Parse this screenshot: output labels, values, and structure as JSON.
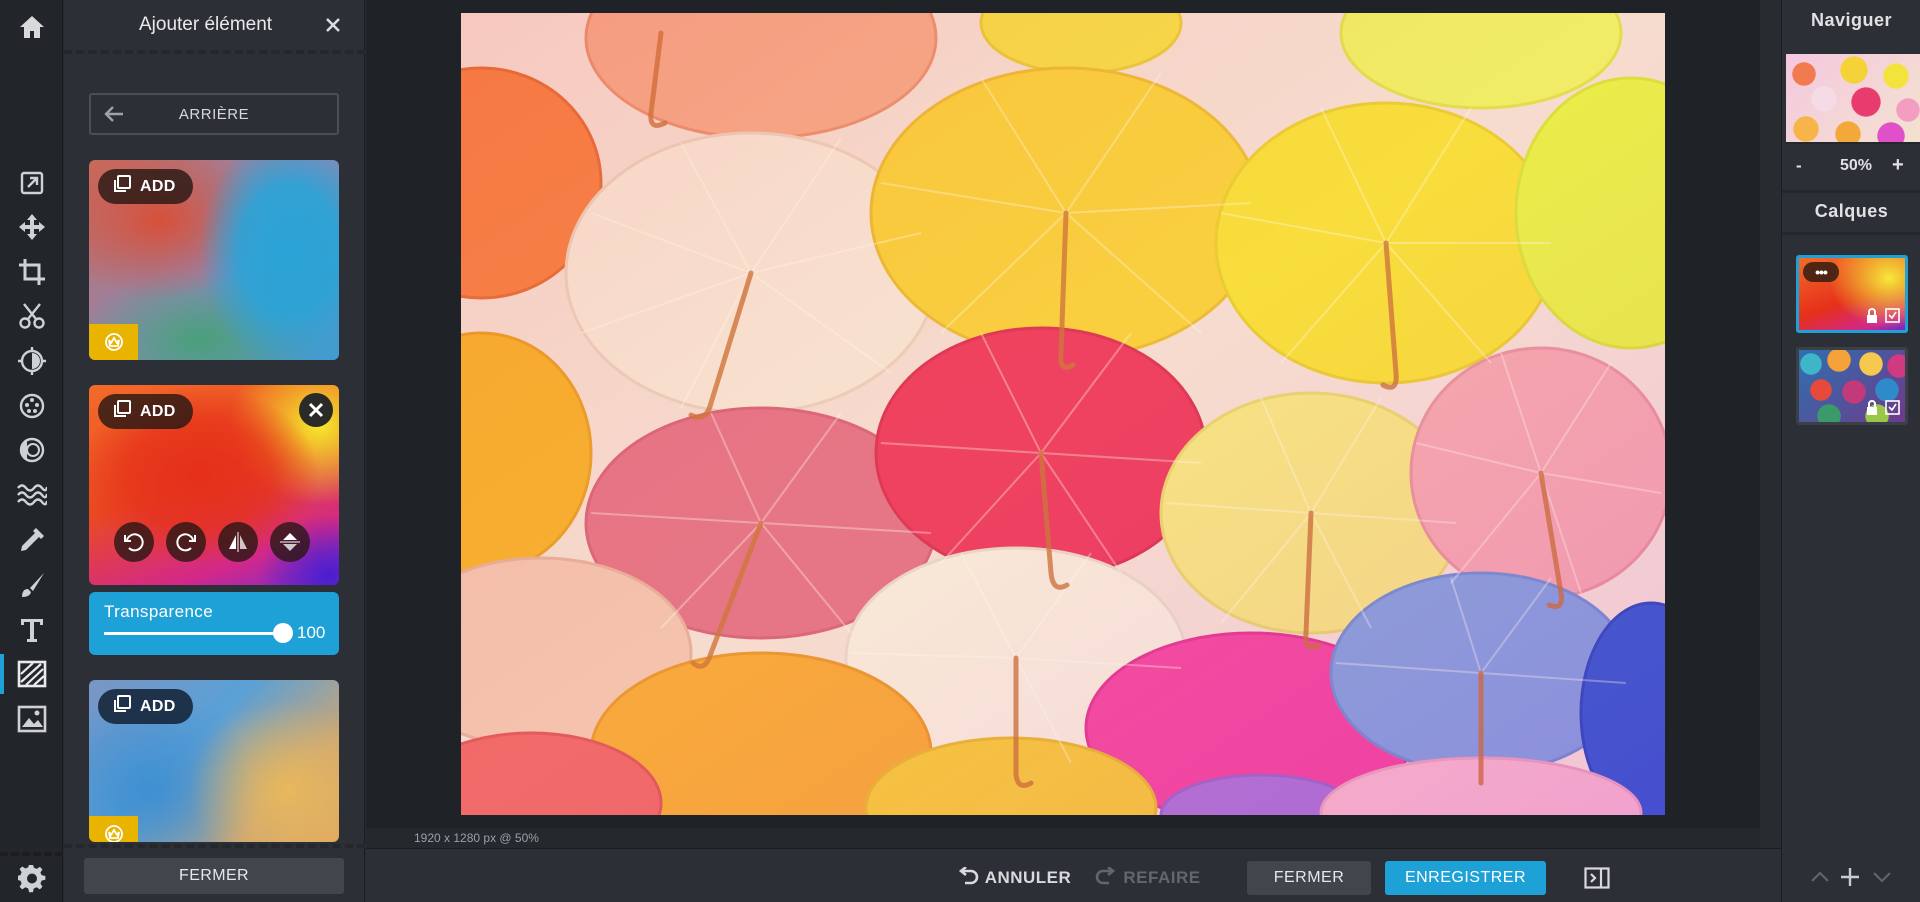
{
  "panel": {
    "title": "Ajouter élément",
    "back_label": "ARRIÈRE",
    "add_label": "ADD",
    "transparency_label": "Transparence",
    "transparency_value": "100",
    "close_label": "FERMER"
  },
  "tools": [
    "home-icon",
    "open-image-icon",
    "move-icon",
    "crop-icon",
    "cut-icon",
    "adjust-icon",
    "effects-icon",
    "vignette-icon",
    "wave-icon",
    "eyedropper-icon",
    "brush-icon",
    "text-icon",
    "texture-icon",
    "image-icon",
    "settings-icon"
  ],
  "canvas": {
    "status": "1920 x 1280 px @ 50%"
  },
  "bottombar": {
    "undo_label": "ANNULER",
    "redo_label": "REFAIRE",
    "close_label": "FERMER",
    "save_label": "ENREGISTRER"
  },
  "navigator": {
    "title": "Naviguer",
    "zoom_minus": "-",
    "zoom_value": "50%",
    "zoom_plus": "+"
  },
  "layers": {
    "title": "Calques",
    "more_label": "•••"
  },
  "colors": {
    "accent": "#1da1d6",
    "badge": "#e8b400",
    "panel_bg": "#2c3036"
  }
}
